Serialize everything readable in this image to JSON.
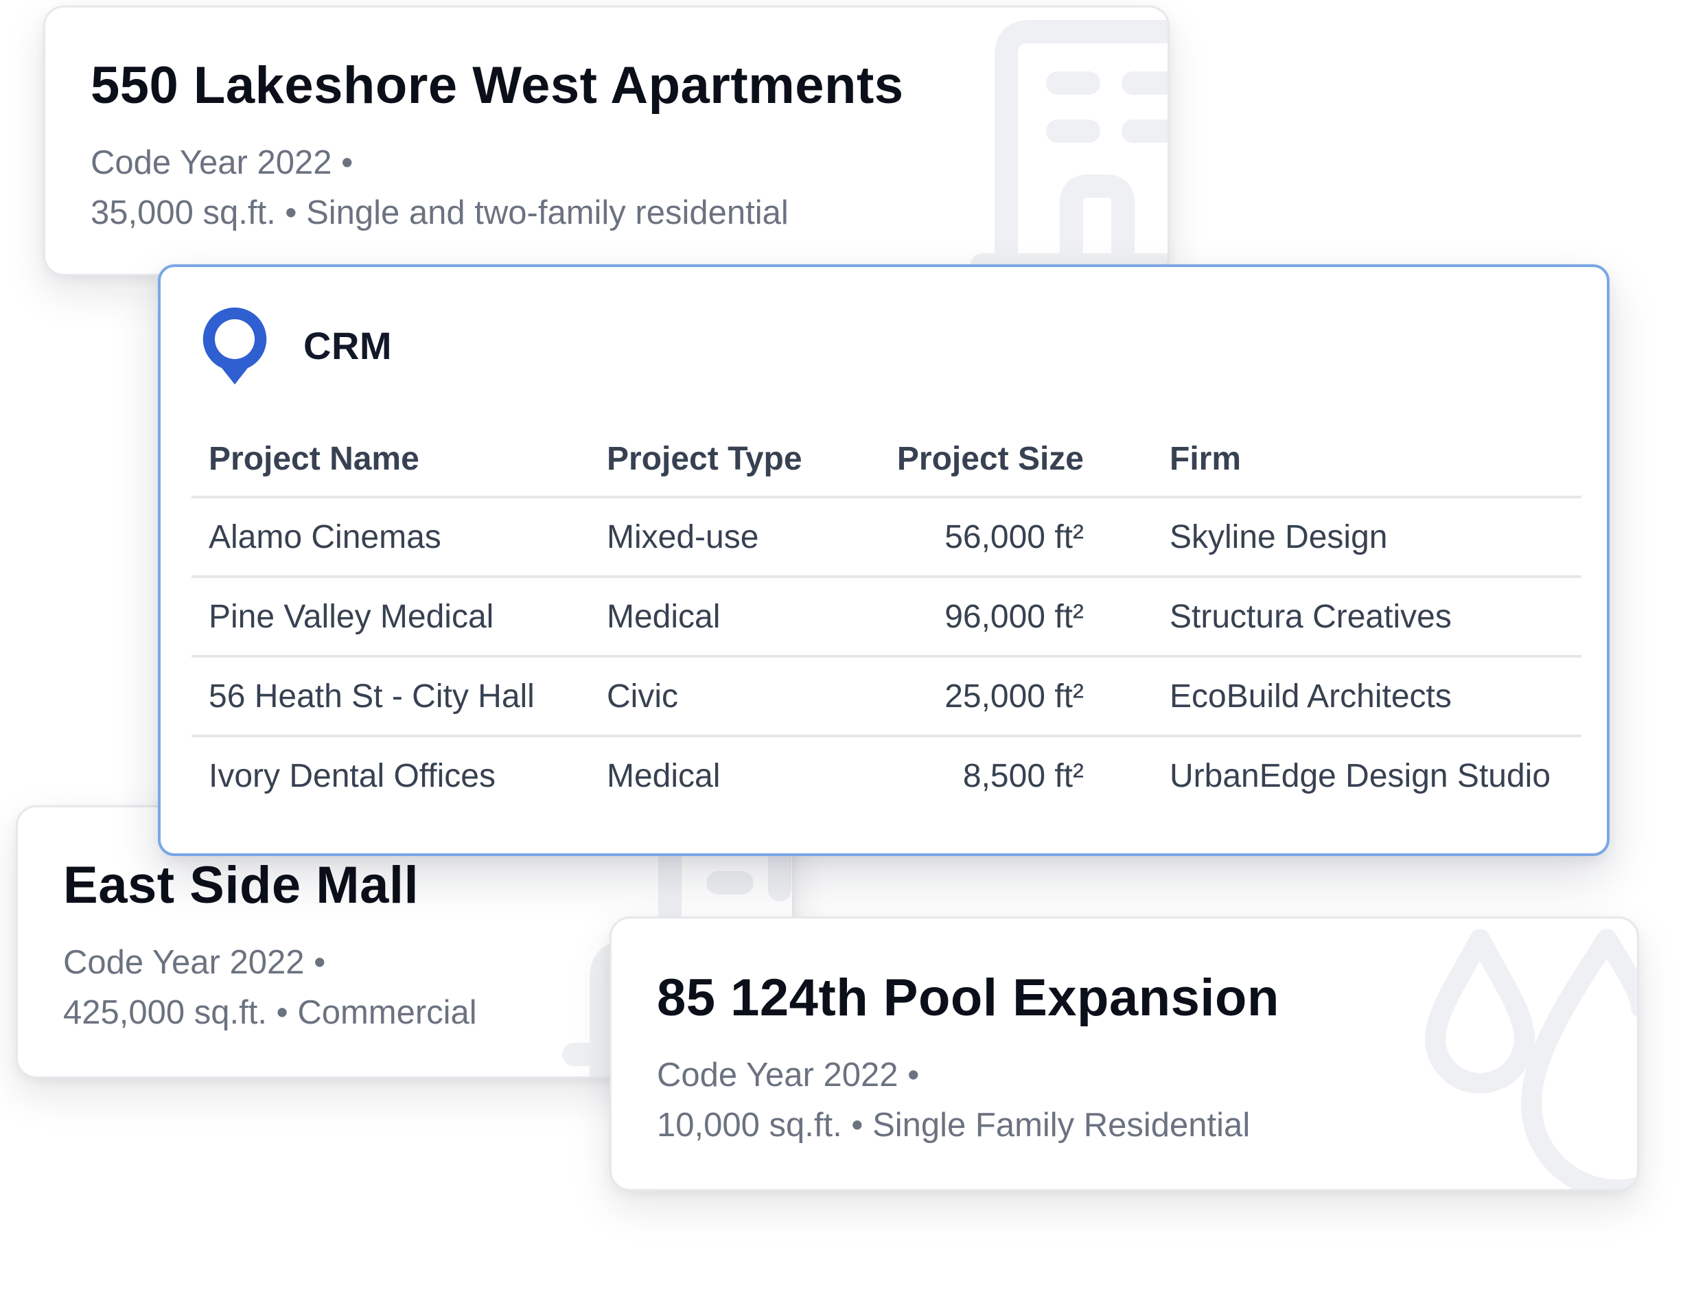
{
  "project_cards": [
    {
      "title": "550 Lakeshore West Apartments",
      "code_year": "Code Year 2022 •",
      "details": "35,000 sq.ft. • Single and two-family residential",
      "icon": "building-icon"
    },
    {
      "title": "East Side Mall",
      "code_year": "Code Year 2022 •",
      "details": "425,000 sq.ft. • Commercial",
      "icon": "building-icon"
    },
    {
      "title": "85 124th Pool Expansion",
      "code_year": "Code Year 2022 •",
      "details": "10,000 sq.ft. • Single Family Residential",
      "icon": "water-drops-icon"
    }
  ],
  "crm": {
    "title": "CRM",
    "logo_icon": "map-pin-icon",
    "columns": [
      "Project Name",
      "Project Type",
      "Project Size",
      "Firm"
    ],
    "rows": [
      [
        "Alamo Cinemas",
        "Mixed-use",
        "56,000 ft²",
        "Skyline Design"
      ],
      [
        "Pine Valley Medical",
        "Medical",
        "96,000 ft²",
        "Structura Creatives"
      ],
      [
        "56 Heath St - City Hall",
        "Civic",
        "25,000 ft²",
        "EcoBuild Architects"
      ],
      [
        "Ivory Dental Offices",
        "Medical",
        "8,500 ft²",
        "UrbanEdge Design Studio"
      ]
    ]
  },
  "colors": {
    "accent": "#2f5fd0",
    "panel_border": "#7aa7e6",
    "title_text": "#0b0f19",
    "meta_text": "#6b7280",
    "watermark": "#eef0f3"
  }
}
